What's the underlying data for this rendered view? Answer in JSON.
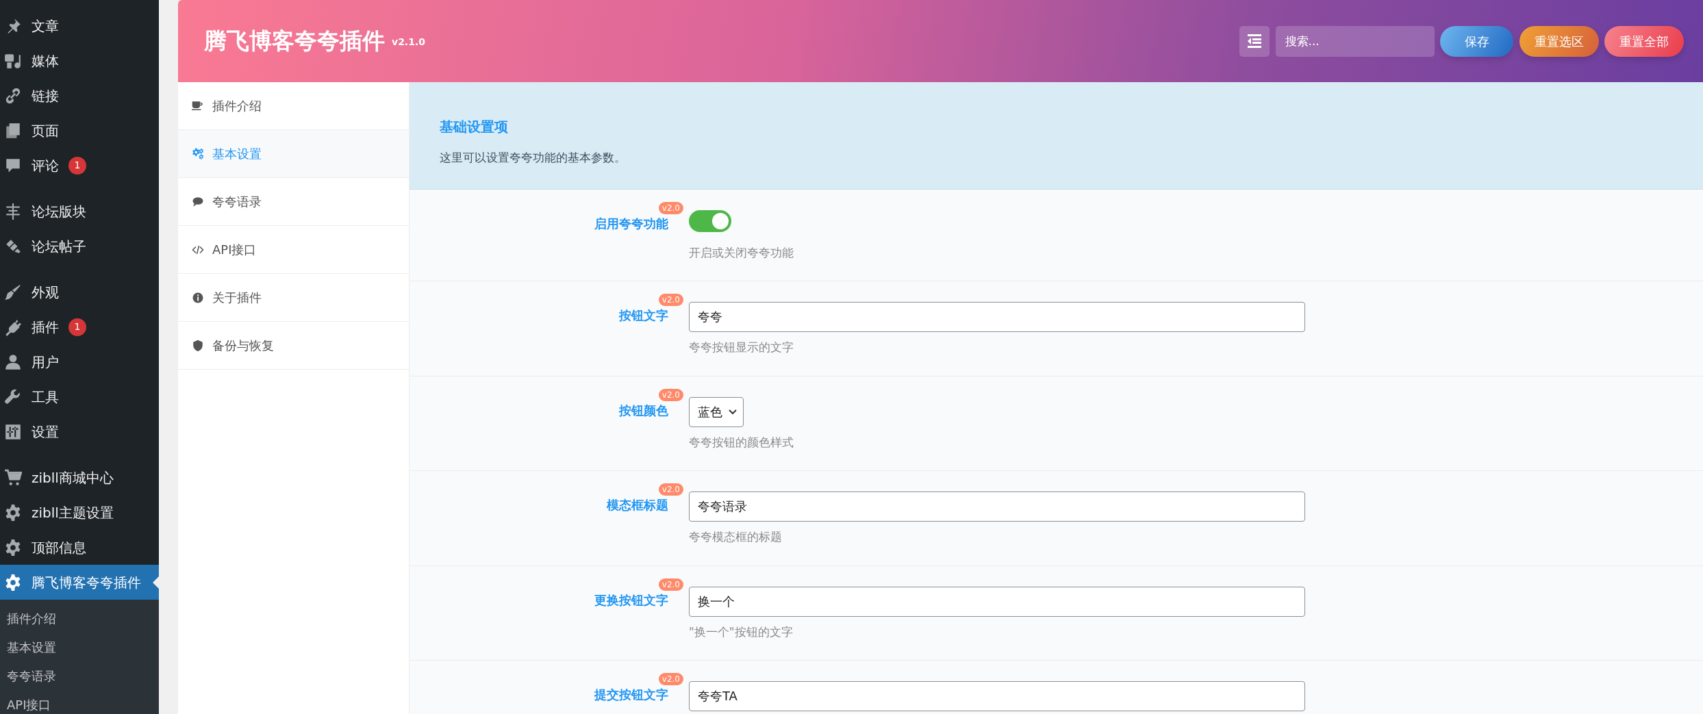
{
  "admin_menu": {
    "groups": [
      [
        {
          "label": "文章",
          "selected": false
        },
        {
          "label": "媒体",
          "selected": false
        },
        {
          "label": "链接",
          "selected": false
        },
        {
          "label": "页面",
          "selected": false
        },
        {
          "label": "评论",
          "count": "1",
          "selected": false
        }
      ],
      [
        {
          "label": "论坛版块",
          "selected": false
        },
        {
          "label": "论坛帖子",
          "selected": false
        }
      ],
      [
        {
          "label": "外观",
          "selected": false
        },
        {
          "label": "插件",
          "count": "1",
          "selected": false
        },
        {
          "label": "用户",
          "selected": false
        },
        {
          "label": "工具",
          "selected": false
        },
        {
          "label": "设置",
          "selected": false
        }
      ],
      [
        {
          "label": "zibll商城中心",
          "selected": false
        },
        {
          "label": "zibll主题设置",
          "selected": false
        },
        {
          "label": "顶部信息",
          "selected": false
        },
        {
          "label": "腾飞博客夸夸插件",
          "selected": true
        }
      ]
    ],
    "submenu": [
      "插件介绍",
      "基本设置",
      "夸夸语录",
      "API接口"
    ]
  },
  "header": {
    "title": "腾飞博客夸夸插件",
    "version": "v2.1.0",
    "search": {
      "placeholder": "搜索..."
    },
    "buttons": [
      "保存",
      "重置选区",
      "重置全部"
    ]
  },
  "settings_nav": [
    {
      "label": "插件介绍",
      "selected": false
    },
    {
      "label": "基本设置",
      "selected": true
    },
    {
      "label": "夸夸语录",
      "selected": false
    },
    {
      "label": "API接口",
      "selected": false
    },
    {
      "label": "关于插件",
      "selected": false
    },
    {
      "label": "备份与恢复",
      "selected": false
    }
  ],
  "section": {
    "title": "基础设置项",
    "description": "这里可以设置夸夸功能的基本参数。"
  },
  "fields": [
    {
      "kind": "switch",
      "label": "启用夸夸功能",
      "badge": "v2.0",
      "on": true,
      "description": "开启或关闭夸夸功能"
    },
    {
      "kind": "text",
      "label": "按钮文字",
      "badge": "v2.0",
      "value": "夸夸",
      "description": "夸夸按钮显示的文字"
    },
    {
      "kind": "select",
      "label": "按钮颜色",
      "badge": "v2.0",
      "value": "蓝色",
      "description": "夸夸按钮的颜色样式"
    },
    {
      "kind": "text",
      "label": "模态框标题",
      "badge": "v2.0",
      "value": "夸夸语录",
      "description": "夸夸模态框的标题"
    },
    {
      "kind": "text",
      "label": "更换按钮文字",
      "badge": "v2.0",
      "value": "换一个",
      "description": "\"换一个\"按钮的文字"
    },
    {
      "kind": "text",
      "label": "提交按钮文字",
      "badge": "v2.0",
      "value": "夸夸TA"
    }
  ]
}
